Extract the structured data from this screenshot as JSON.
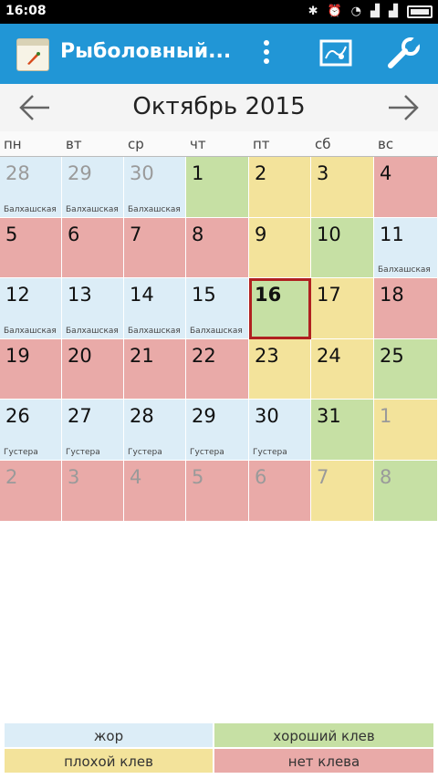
{
  "status_bar": {
    "time": "16:08"
  },
  "app_bar": {
    "title": "Рыболовный..."
  },
  "calendar": {
    "month_title": "Октябрь 2015",
    "weekdays": [
      "пн",
      "вт",
      "ср",
      "чт",
      "пт",
      "сб",
      "вс"
    ],
    "days": [
      {
        "num": "28",
        "sub": "Балхашская",
        "type": "zhor",
        "muted": true
      },
      {
        "num": "29",
        "sub": "Балхашская",
        "type": "zhor",
        "muted": true
      },
      {
        "num": "30",
        "sub": "Балхашская",
        "type": "zhor",
        "muted": true
      },
      {
        "num": "1",
        "sub": "",
        "type": "good",
        "muted": false
      },
      {
        "num": "2",
        "sub": "",
        "type": "bad",
        "muted": false
      },
      {
        "num": "3",
        "sub": "",
        "type": "bad",
        "muted": false
      },
      {
        "num": "4",
        "sub": "",
        "type": "none",
        "muted": false
      },
      {
        "num": "5",
        "sub": "",
        "type": "none",
        "muted": false
      },
      {
        "num": "6",
        "sub": "",
        "type": "none",
        "muted": false
      },
      {
        "num": "7",
        "sub": "",
        "type": "none",
        "muted": false
      },
      {
        "num": "8",
        "sub": "",
        "type": "none",
        "muted": false
      },
      {
        "num": "9",
        "sub": "",
        "type": "bad",
        "muted": false
      },
      {
        "num": "10",
        "sub": "",
        "type": "good",
        "muted": false
      },
      {
        "num": "11",
        "sub": "Балхашская",
        "type": "zhor",
        "muted": false
      },
      {
        "num": "12",
        "sub": "Балхашская",
        "type": "zhor",
        "muted": false
      },
      {
        "num": "13",
        "sub": "Балхашская",
        "type": "zhor",
        "muted": false
      },
      {
        "num": "14",
        "sub": "Балхашская",
        "type": "zhor",
        "muted": false
      },
      {
        "num": "15",
        "sub": "Балхашская",
        "type": "zhor",
        "muted": false
      },
      {
        "num": "16",
        "sub": "",
        "type": "good",
        "muted": false,
        "today": true
      },
      {
        "num": "17",
        "sub": "",
        "type": "bad",
        "muted": false
      },
      {
        "num": "18",
        "sub": "",
        "type": "none",
        "muted": false
      },
      {
        "num": "19",
        "sub": "",
        "type": "none",
        "muted": false
      },
      {
        "num": "20",
        "sub": "",
        "type": "none",
        "muted": false
      },
      {
        "num": "21",
        "sub": "",
        "type": "none",
        "muted": false
      },
      {
        "num": "22",
        "sub": "",
        "type": "none",
        "muted": false
      },
      {
        "num": "23",
        "sub": "",
        "type": "bad",
        "muted": false
      },
      {
        "num": "24",
        "sub": "",
        "type": "bad",
        "muted": false
      },
      {
        "num": "25",
        "sub": "",
        "type": "good",
        "muted": false
      },
      {
        "num": "26",
        "sub": "Густера",
        "type": "zhor",
        "muted": false
      },
      {
        "num": "27",
        "sub": "Густера",
        "type": "zhor",
        "muted": false
      },
      {
        "num": "28",
        "sub": "Густера",
        "type": "zhor",
        "muted": false
      },
      {
        "num": "29",
        "sub": "Густера",
        "type": "zhor",
        "muted": false
      },
      {
        "num": "30",
        "sub": "Густера",
        "type": "zhor",
        "muted": false
      },
      {
        "num": "31",
        "sub": "",
        "type": "good",
        "muted": false
      },
      {
        "num": "1",
        "sub": "",
        "type": "bad",
        "muted": true
      },
      {
        "num": "2",
        "sub": "",
        "type": "none",
        "muted": true
      },
      {
        "num": "3",
        "sub": "",
        "type": "none",
        "muted": true
      },
      {
        "num": "4",
        "sub": "",
        "type": "none",
        "muted": true
      },
      {
        "num": "5",
        "sub": "",
        "type": "none",
        "muted": true
      },
      {
        "num": "6",
        "sub": "",
        "type": "none",
        "muted": true
      },
      {
        "num": "7",
        "sub": "",
        "type": "bad",
        "muted": true
      },
      {
        "num": "8",
        "sub": "",
        "type": "good",
        "muted": true
      }
    ]
  },
  "legend": {
    "zhor": "жор",
    "good": "хороший клев",
    "bad": "плохой клев",
    "none": "нет клева"
  },
  "colors": {
    "zhor": "#dcedf7",
    "good": "#c6e0a4",
    "bad": "#f3e39b",
    "none": "#e9aaa8",
    "accent": "#2196d6",
    "today_border": "#b02020"
  },
  "icons": {
    "app": "fishing-calendar-icon",
    "menu": "overflow-menu-icon",
    "map": "map-icon",
    "settings": "wrench-icon",
    "prev": "arrow-left-icon",
    "next": "arrow-right-icon"
  }
}
